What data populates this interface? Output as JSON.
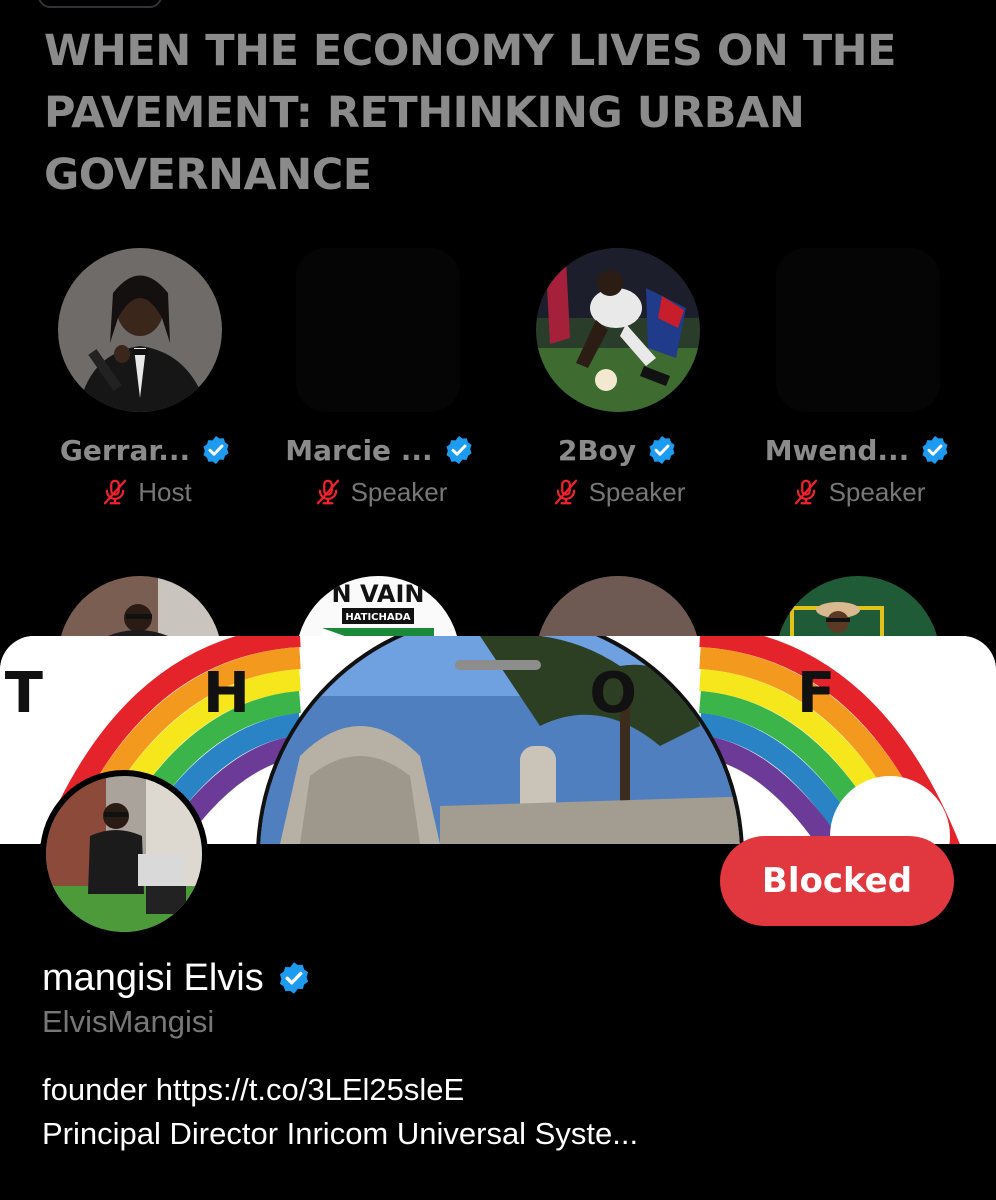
{
  "space": {
    "title": "WHEN THE ECONOMY LIVES ON THE PAVEMENT: RETHINKING URBAN GOVERNANCE",
    "participants": [
      {
        "name": "Gerrar...",
        "role": "Host"
      },
      {
        "name": "Marcie ...",
        "role": "Speaker"
      },
      {
        "name": "2Boy",
        "role": "Speaker"
      },
      {
        "name": "Mwend...",
        "role": "Speaker"
      }
    ],
    "second_row_logo_text": "N VAIN",
    "second_row_logo_subtext": "HATICHADA"
  },
  "profile": {
    "banner_text": "TH  OF",
    "display_name": "mangisi Elvis",
    "handle": "ElvisMangisi",
    "bio_line1": "founder https://t.co/3LEl25sleE",
    "bio_line2": "Principal Director Inricom Universal Syste...",
    "blocked_label": "Blocked"
  },
  "colors": {
    "background": "#000000",
    "title_gray": "#8b8b8b",
    "verified_blue": "#1d9bf0",
    "muted_mic_red": "#f4212e",
    "blocked_red": "#e0383e"
  },
  "icons": [
    "verified-badge-icon",
    "muted-mic-icon"
  ]
}
